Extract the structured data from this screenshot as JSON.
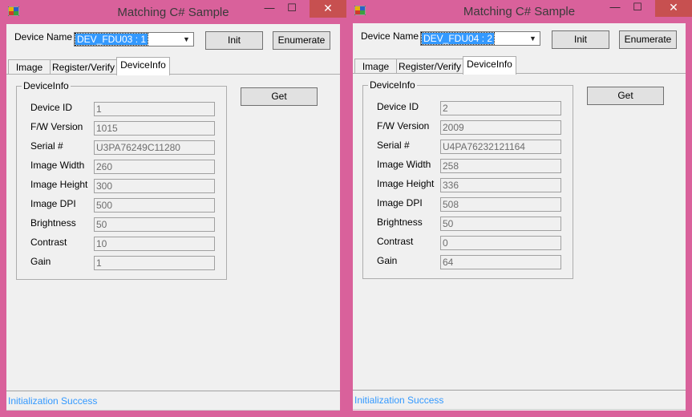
{
  "windows": [
    {
      "title": "Matching C# Sample",
      "device_name_label": "Device Name",
      "device_name_value": "DEV_FDU03 : 1",
      "init_button": "Init",
      "enumerate_button": "Enumerate",
      "tabs": [
        "Image",
        "Register/Verify",
        "DeviceInfo"
      ],
      "active_tab": "DeviceInfo",
      "groupbox_title": "DeviceInfo",
      "get_button": "Get",
      "fields": [
        {
          "label": "Device ID",
          "value": "1"
        },
        {
          "label": "F/W Version",
          "value": "1015"
        },
        {
          "label": "Serial #",
          "value": "U3PA76249C11280"
        },
        {
          "label": "Image Width",
          "value": "260"
        },
        {
          "label": "Image Height",
          "value": "300"
        },
        {
          "label": "Image DPI",
          "value": "500"
        },
        {
          "label": "Brightness",
          "value": "50"
        },
        {
          "label": "Contrast",
          "value": "10"
        },
        {
          "label": "Gain",
          "value": "1"
        }
      ],
      "status": "Initialization Success"
    },
    {
      "title": "Matching C# Sample",
      "device_name_label": "Device Name",
      "device_name_value": "DEV_FDU04 : 2",
      "init_button": "Init",
      "enumerate_button": "Enumerate",
      "tabs": [
        "Image",
        "Register/Verify",
        "DeviceInfo"
      ],
      "active_tab": "DeviceInfo",
      "groupbox_title": "DeviceInfo",
      "get_button": "Get",
      "fields": [
        {
          "label": "Device ID",
          "value": "2"
        },
        {
          "label": "F/W Version",
          "value": "2009"
        },
        {
          "label": "Serial #",
          "value": "U4PA76232121164"
        },
        {
          "label": "Image Width",
          "value": "258"
        },
        {
          "label": "Image Height",
          "value": "336"
        },
        {
          "label": "Image DPI",
          "value": "508"
        },
        {
          "label": "Brightness",
          "value": "50"
        },
        {
          "label": "Contrast",
          "value": "0"
        },
        {
          "label": "Gain",
          "value": "64"
        }
      ],
      "status": "Initialization Success"
    }
  ],
  "caption_buttons": {
    "minimize": "—",
    "maximize": "☐",
    "close": "✕"
  },
  "colors": {
    "frame": "#d9619b",
    "close": "#c75050",
    "selection": "#3399ff",
    "status_text": "#3399ff"
  },
  "icons": {
    "app": "app-window-icon",
    "dropdown": "chevron-down-icon"
  }
}
